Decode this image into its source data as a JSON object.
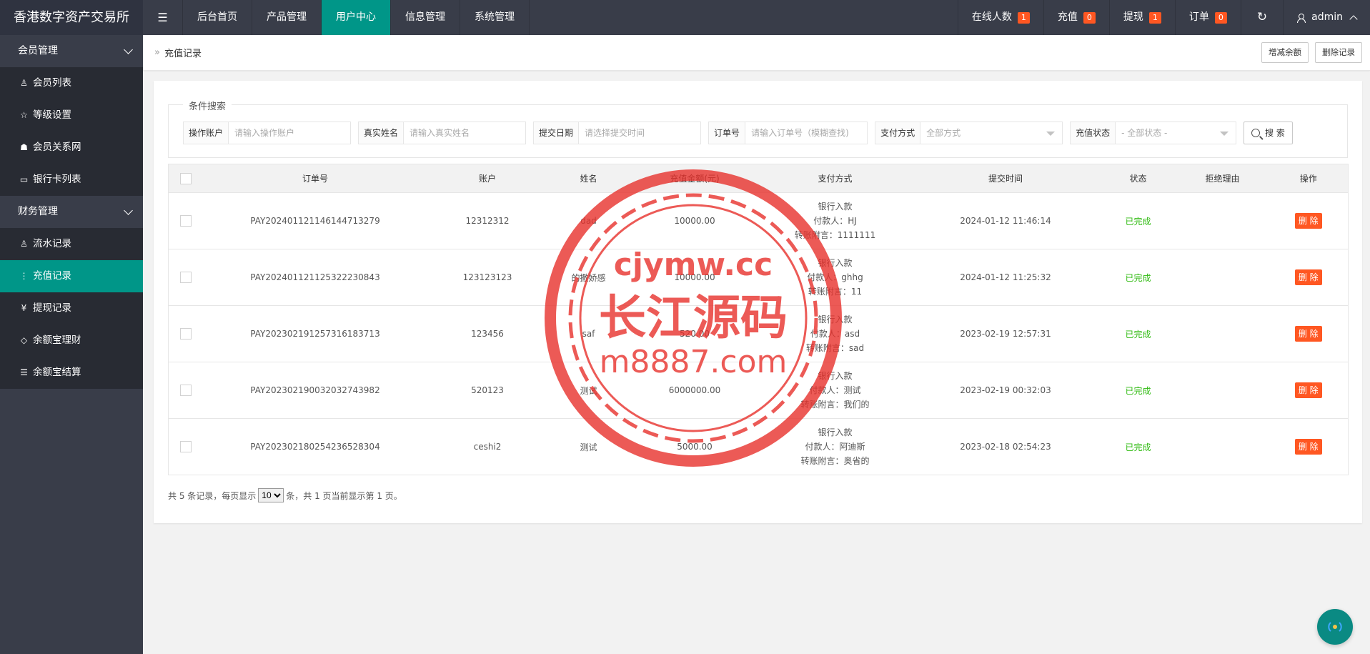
{
  "brand": "香港数字资产交易所",
  "nav": [
    "后台首页",
    "产品管理",
    "用户中心",
    "信息管理",
    "系统管理"
  ],
  "top_right": {
    "online_label": "在线人数",
    "online_count": "1",
    "recharge_label": "充值",
    "recharge_count": "0",
    "withdraw_label": "提现",
    "withdraw_count": "1",
    "order_label": "订单",
    "order_count": "0",
    "user": "admin"
  },
  "sidebar": {
    "group1": "会员管理",
    "group1_items": [
      "会员列表",
      "等级设置",
      "会员关系网",
      "银行卡列表"
    ],
    "group2": "财务管理",
    "group2_items": [
      "流水记录",
      "充值记录",
      "提现记录",
      "余额宝理财",
      "余额宝结算"
    ]
  },
  "breadcrumb": {
    "sep": "»",
    "title": "充值记录"
  },
  "actions": {
    "adjust": "增减余额",
    "delete_records": "删除记录"
  },
  "search": {
    "legend": "条件搜索",
    "account_label": "操作账户",
    "account_placeholder": "请输入操作账户",
    "name_label": "真实姓名",
    "name_placeholder": "请输入真实姓名",
    "date_label": "提交日期",
    "date_placeholder": "请选择提交时间",
    "order_label": "订单号",
    "order_placeholder": "请输入订单号（模糊查找)",
    "pay_label": "支付方式",
    "pay_value": "全部方式",
    "status_label": "充值状态",
    "status_value": "- 全部状态 -",
    "button": "搜 索"
  },
  "table": {
    "headers": [
      "订单号",
      "账户",
      "姓名",
      "充值金额(元)",
      "支付方式",
      "提交时间",
      "状态",
      "拒绝理由",
      "操作"
    ],
    "rows": [
      {
        "order": "PAY20240112114614471327​9",
        "account": "12312312",
        "name": "dad",
        "amount": "10000.00",
        "pay1": "银行入款",
        "pay2": "付款人：HJ",
        "pay3": "转账附言：1111111",
        "time": "2024-01-12 11:46:14",
        "status": "已完成",
        "reason": "",
        "op": "删 除"
      },
      {
        "order": "PAY20240112112532223084​3",
        "account": "123123123",
        "name": "的撒娇感",
        "amount": "10000.00",
        "pay1": "银行入款",
        "pay2": "付款人：ghhg",
        "pay3": "转账附言：11",
        "time": "2024-01-12 11:25:32",
        "status": "已完成",
        "reason": "",
        "op": "删 除"
      },
      {
        "order": "PAY20230219125731618371​3",
        "account": "123456",
        "name": "saf",
        "amount": "520.00",
        "pay1": "银行入款",
        "pay2": "付款人：asd",
        "pay3": "转账附言：sad",
        "time": "2023-02-19 12:57:31",
        "status": "已完成",
        "reason": "",
        "op": "删 除"
      },
      {
        "order": "PAY20230219003203274398​2",
        "account": "520123",
        "name": "测试",
        "amount": "6000000.00",
        "pay1": "银行入款",
        "pay2": "付款人：测试",
        "pay3": "转账附言：我们的",
        "time": "2023-02-19 00:32:03",
        "status": "已完成",
        "reason": "",
        "op": "删 除"
      },
      {
        "order": "PAY20230218025423652830​4",
        "account": "ceshi2",
        "name": "测试",
        "amount": "5000.00",
        "pay1": "银行入款",
        "pay2": "付款人：阿迪斯",
        "pay3": "转账附言：奥省的",
        "time": "2023-02-18 02:54:23",
        "status": "已完成",
        "reason": "",
        "op": "删 除"
      }
    ]
  },
  "pager": {
    "pre": "共 5 条记录，每页显示",
    "size": "10",
    "post": "条，共 1 页当前显示第 1 页。"
  },
  "watermark": {
    "line1": "cjymw.cc",
    "line2": "长江源码",
    "line3": "m8887.com"
  }
}
